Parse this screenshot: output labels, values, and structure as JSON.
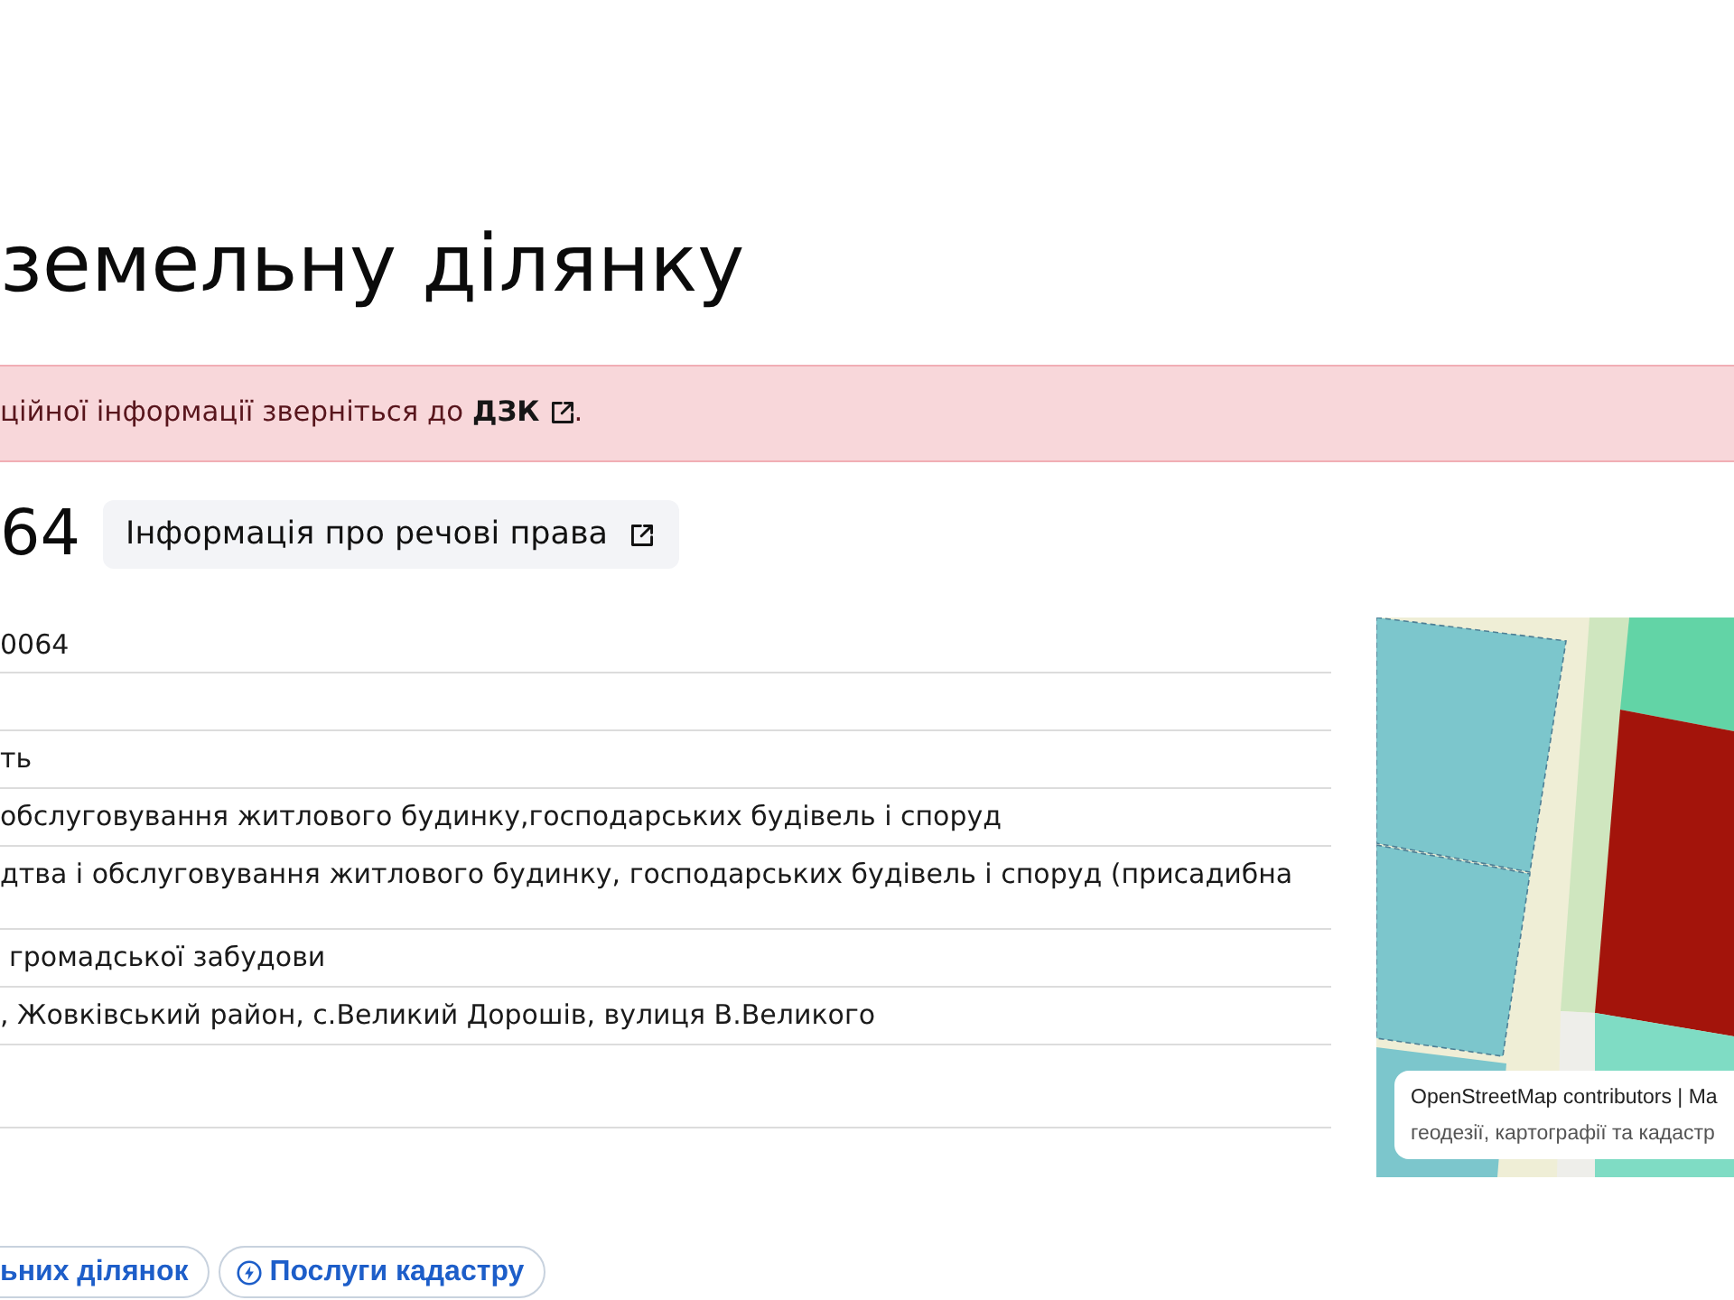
{
  "page_title": "земельну ділянку",
  "alert": {
    "text": "ційної інформації зверніться до",
    "link": "ДЗК",
    "end": "."
  },
  "parcel": {
    "heading": "64",
    "rights_button": "Інформація про речові права"
  },
  "details": [
    {
      "kind": "text",
      "value": "0064"
    },
    {
      "kind": "blank"
    },
    {
      "kind": "text",
      "value": "ть"
    },
    {
      "kind": "text",
      "value": "обслуговування житлового будинку,господарських будівель і споруд"
    },
    {
      "kind": "text",
      "value": "дтва і обслуговування житлового будинку, господарських будівель і споруд (присадибна"
    },
    {
      "kind": "text",
      "value": "громадської забудови"
    },
    {
      "kind": "text",
      "value": ", Жовківський район, с.Великий Дорошів, вулиця В.Великого"
    },
    {
      "kind": "blank"
    }
  ],
  "map": {
    "attribution": [
      "OpenStreetMap contributors | Ma",
      "геодезії, картографії та кадастр"
    ]
  },
  "links": [
    {
      "kind": "plain",
      "label": "ьних ділянок"
    },
    {
      "kind": "iconed",
      "label": "Послуги кадастру"
    }
  ]
}
